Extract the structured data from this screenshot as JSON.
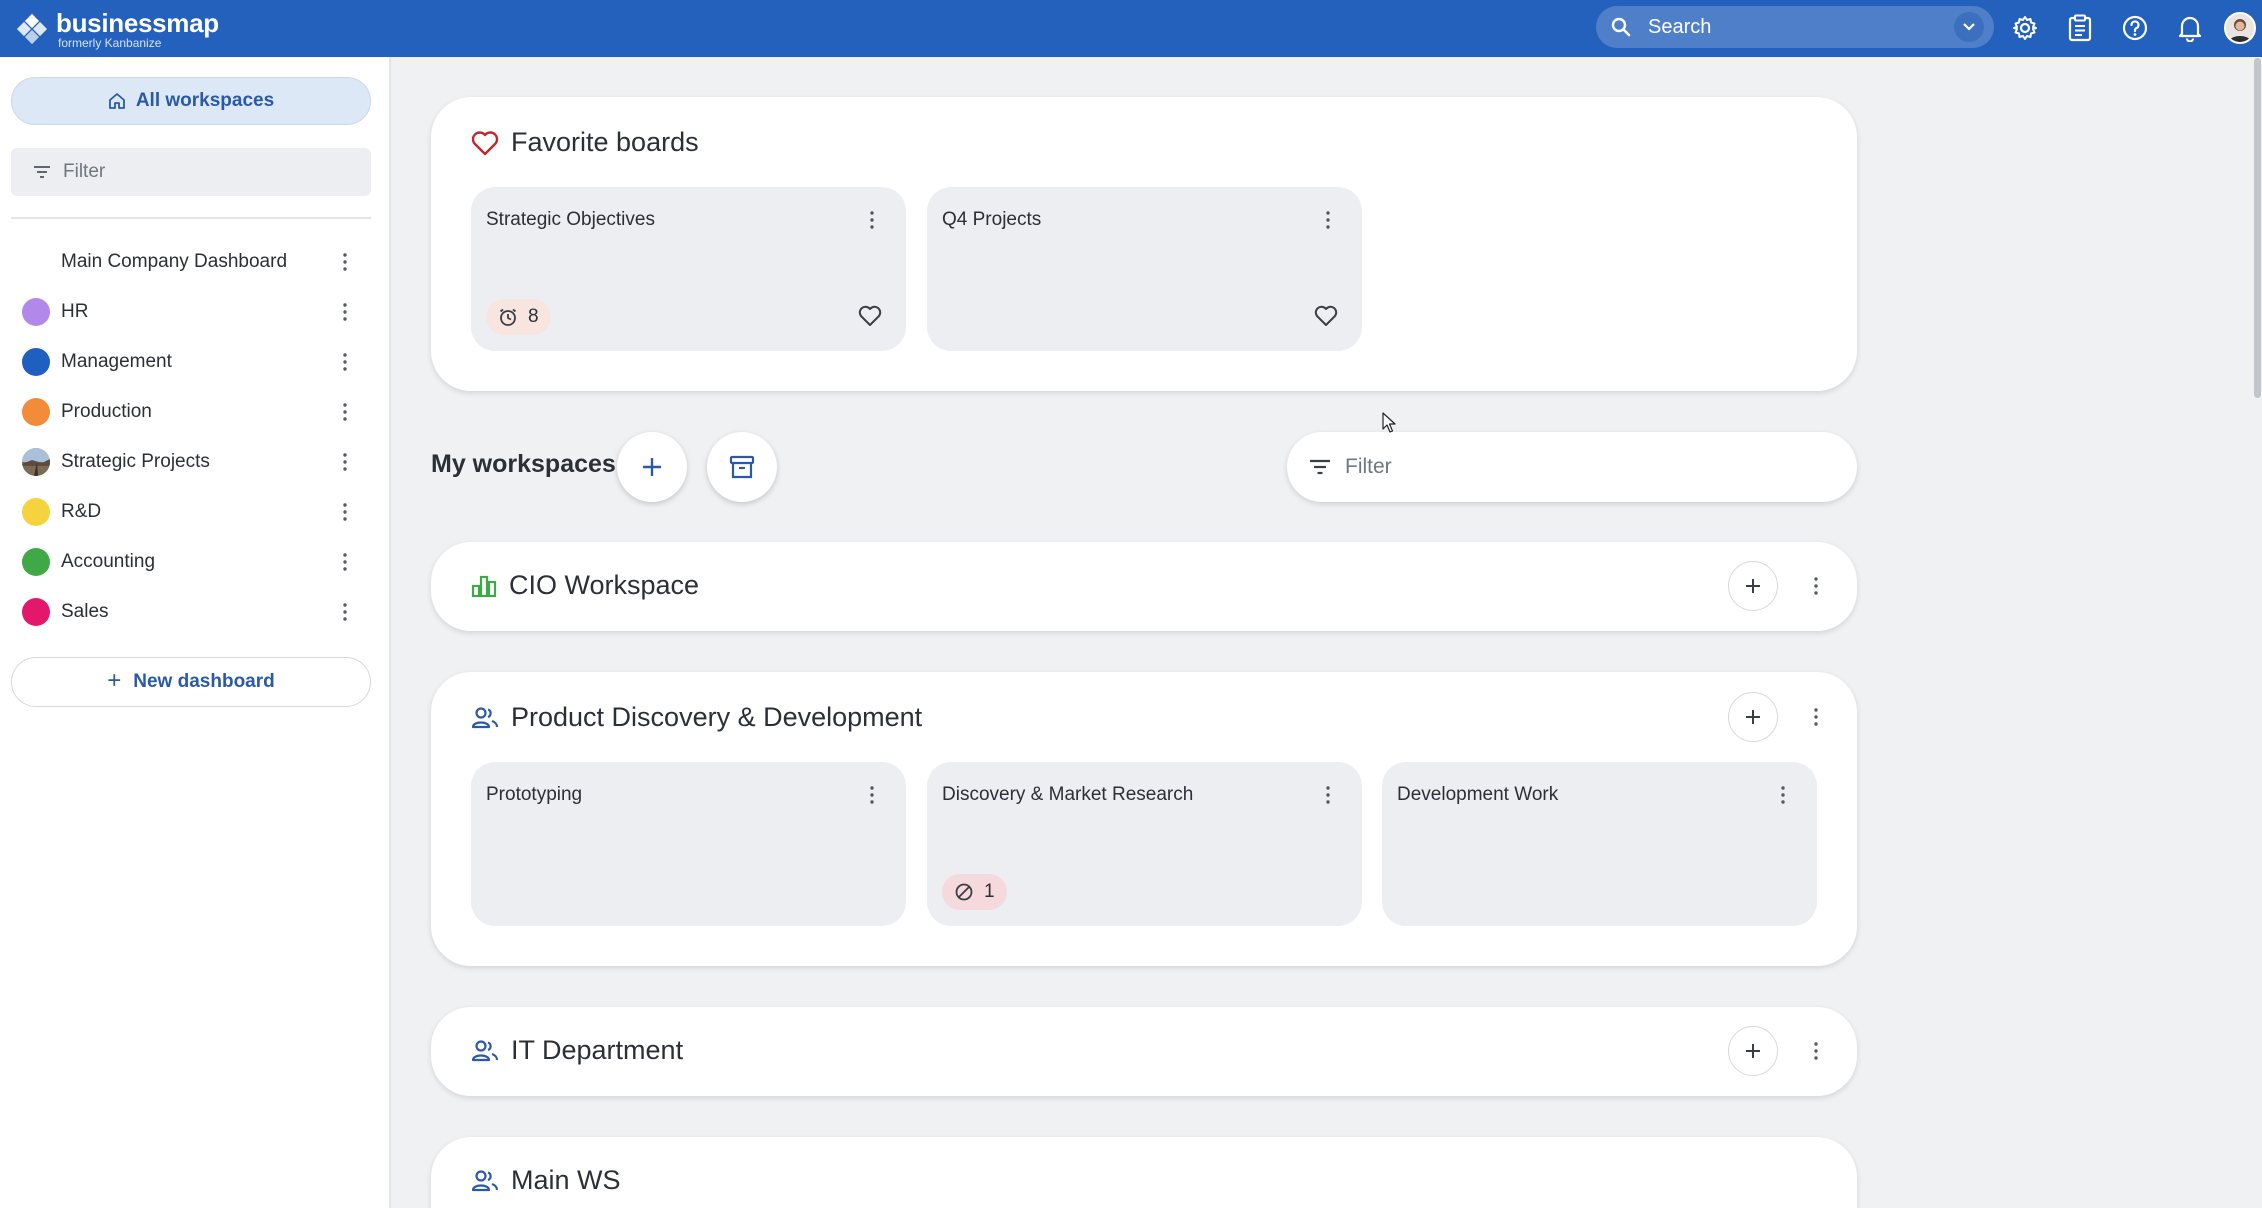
{
  "header": {
    "brand": "businessmap",
    "brand_sub": "formerly Kanbanize",
    "search_placeholder": "Search",
    "brand_color": "#2461bd"
  },
  "sidebar": {
    "all_workspaces_label": "All workspaces",
    "filter_placeholder": "Filter",
    "dashboards": [
      {
        "label": "Main Company Dashboard",
        "color": ""
      },
      {
        "label": "HR",
        "color": "#b388eb"
      },
      {
        "label": "Management",
        "color": "#1f5fbf"
      },
      {
        "label": "Production",
        "color": "#f28c38"
      },
      {
        "label": "Strategic Projects",
        "color": "image"
      },
      {
        "label": "R&D",
        "color": "#f5d33c"
      },
      {
        "label": "Accounting",
        "color": "#3fa847"
      },
      {
        "label": "Sales",
        "color": "#e3186b"
      }
    ],
    "new_dashboard_label": "New dashboard"
  },
  "favorites": {
    "title": "Favorite boards",
    "boards": [
      {
        "title": "Strategic Objectives",
        "badge_count": "8"
      },
      {
        "title": "Q4 Projects"
      }
    ]
  },
  "workspaces": {
    "heading": "My workspaces",
    "filter_placeholder": "Filter",
    "items": [
      {
        "title": "CIO Workspace",
        "icon": "chart-icon"
      },
      {
        "title": "Product Discovery & Development",
        "icon": "team-icon",
        "boards": [
          {
            "title": "Prototyping"
          },
          {
            "title": "Discovery & Market Research",
            "badge_count": "1"
          },
          {
            "title": "Development Work"
          }
        ]
      },
      {
        "title": "IT Department",
        "icon": "team-icon"
      },
      {
        "title": "Main WS",
        "icon": "team-icon"
      }
    ]
  }
}
